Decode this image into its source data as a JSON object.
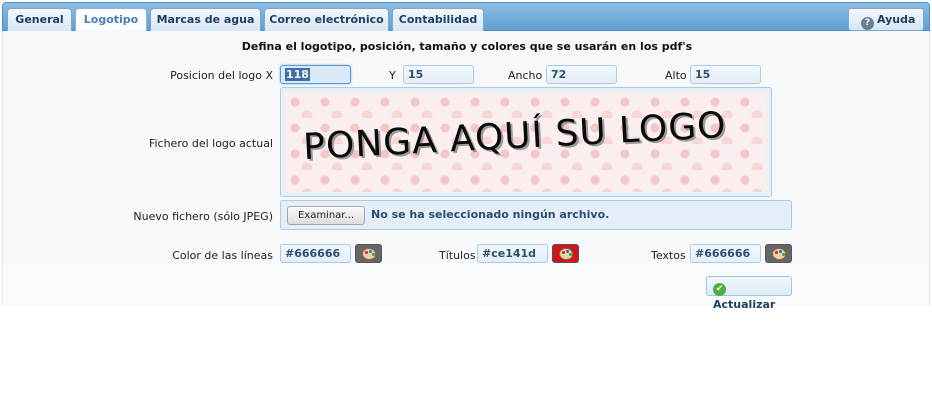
{
  "tabs": [
    {
      "label": "General"
    },
    {
      "label": "Logotipo"
    },
    {
      "label": "Marcas de agua"
    },
    {
      "label": "Correo electrónico"
    },
    {
      "label": "Contabilidad"
    }
  ],
  "active_tab": "Logotipo",
  "help": {
    "label": "Ayuda",
    "icon": "help-icon"
  },
  "heading": "Defina el logotipo, posición, tamaño y colores que se usarán en los pdf's",
  "position": {
    "x_label": "Posicion del logo X",
    "x_value": "118",
    "y_label": "Y",
    "y_value": "15",
    "width_label": "Ancho",
    "width_value": "72",
    "height_label": "Alto",
    "height_value": "15"
  },
  "current_logo": {
    "label": "Fichero del logo actual",
    "image_text": "PONGA AQUÍ SU LOGO"
  },
  "new_file": {
    "label": "Nuevo fichero (sólo JPEG)",
    "button": "Examinar...",
    "status": "No se ha seleccionado ningún archivo."
  },
  "colors": {
    "lines_label": "Color de las líneas",
    "lines_value": "#666666",
    "lines_swatch": "#666666",
    "titles_label": "Títulos",
    "titles_value": "#ce141d",
    "titles_swatch": "#ce141d",
    "texts_label": "Textos",
    "texts_value": "#666666",
    "texts_swatch": "#666666"
  },
  "update_button": {
    "label": "Actualizar",
    "icon": "check-icon"
  }
}
